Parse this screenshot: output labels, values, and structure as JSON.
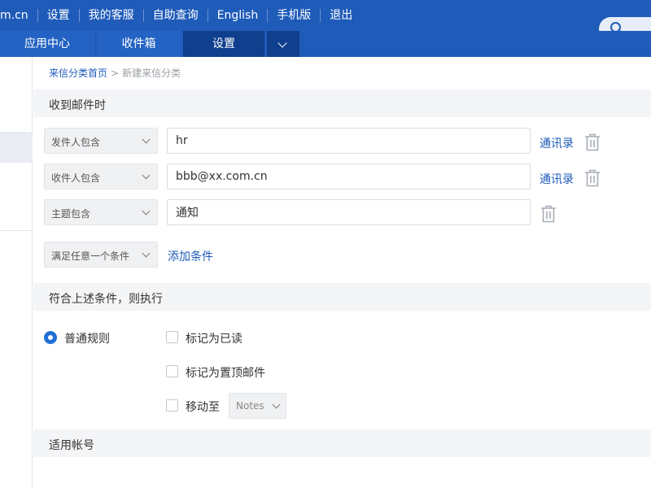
{
  "topnav": {
    "domain": "m.cn",
    "items": [
      "设置",
      "我的客服",
      "自助查询",
      "English",
      "手机版",
      "退出"
    ]
  },
  "tabs": {
    "app_center": "应用中心",
    "inbox": "收件箱",
    "settings": "设置"
  },
  "breadcrumb": {
    "home": "来信分类首页",
    "separator": ">",
    "current": "新建来信分类"
  },
  "section_receive": {
    "title": "收到邮件时",
    "conditions": [
      {
        "field": "发件人包含",
        "value": "hr",
        "link": "通讯录"
      },
      {
        "field": "收件人包含",
        "value": "bbb@xx.com.cn",
        "link": "通讯录"
      },
      {
        "field": "主题包含",
        "value": "通知",
        "link": ""
      }
    ],
    "match_mode": "满足任意一个条件",
    "add_condition": "添加条件"
  },
  "section_action": {
    "title": "符合上述条件，则执行",
    "rule_type": "普通规则",
    "options": {
      "mark_read": "标记为已读",
      "mark_top": "标记为置顶邮件",
      "move_to": "移动至"
    },
    "folder": "Notes"
  },
  "section_account": {
    "title": "适用帐号"
  },
  "colors": {
    "brand": "#1f5bb9",
    "active_tab": "#0f3f8d",
    "radio": "#1f6fd6"
  },
  "icons": [
    "search-icon",
    "trash-icon",
    "chevron-down-icon",
    "radio-checked-icon"
  ]
}
